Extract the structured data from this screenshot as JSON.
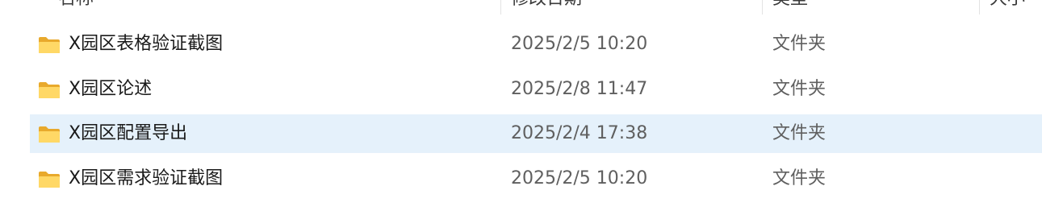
{
  "header": {
    "columns": [
      {
        "label": "名称"
      },
      {
        "label": "修改日期"
      },
      {
        "label": "类型"
      },
      {
        "label": "大小"
      }
    ]
  },
  "files": [
    {
      "name": "X园区表格验证截图",
      "date": "2025/2/5 10:20",
      "type": "文件夹",
      "icon": "folder-icon",
      "selected": false
    },
    {
      "name": "X园区论述",
      "date": "2025/2/8 11:47",
      "type": "文件夹",
      "icon": "folder-icon",
      "selected": false
    },
    {
      "name": "X园区配置导出",
      "date": "2025/2/4 17:38",
      "type": "文件夹",
      "icon": "folder-icon",
      "selected": true
    },
    {
      "name": "X园区需求验证截图",
      "date": "2025/2/5 10:20",
      "type": "文件夹",
      "icon": "folder-icon",
      "selected": false
    }
  ],
  "colors": {
    "selection": "#e5f1fb",
    "folder_body": "#f5c144",
    "folder_front": "#ffd866"
  }
}
